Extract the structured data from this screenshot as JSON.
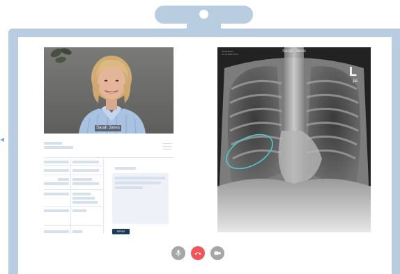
{
  "video": {
    "caller_name": "Sarah Jones"
  },
  "xray": {
    "patient_name": "Sarah Jones",
    "meta_line_1": "#PDM46SR7",
    "meta_line_2": "07.06.2022 11:23",
    "side_marker": "L",
    "view_marker": "pa"
  },
  "form": {
    "send_label": "SEND"
  },
  "controls": {
    "mic_color": "#a6a6a6",
    "hangup_color": "#f0555a",
    "camera_color": "#a6a6a6"
  },
  "colors": {
    "frame": "#b9cde0",
    "placeholder": "#d7e1ee",
    "send": "#1d3a5c",
    "highlight": "#4fc8d0"
  }
}
